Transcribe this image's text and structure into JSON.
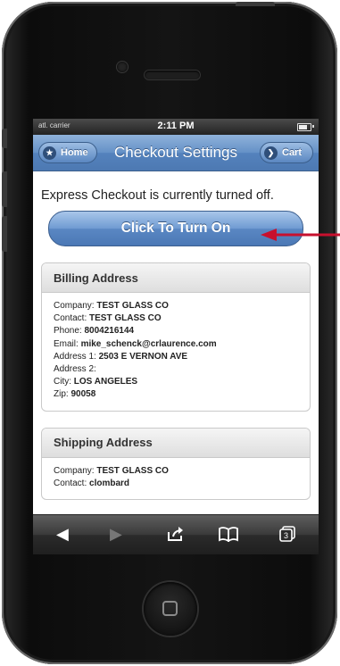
{
  "status_bar": {
    "carrier": "atl. carrier",
    "time": "2:11 PM"
  },
  "header": {
    "title": "Checkout Settings",
    "home_label": "Home",
    "cart_label": "Cart"
  },
  "main": {
    "message": "Express Checkout is currently turned off.",
    "turn_on_label": "Click To Turn On"
  },
  "billing": {
    "heading": "Billing Address",
    "company_label": "Company:",
    "company": "TEST GLASS CO",
    "contact_label": "Contact:",
    "contact": "TEST GLASS CO",
    "phone_label": "Phone:",
    "phone": "8004216144",
    "email_label": "Email:",
    "email": "mike_schenck@crlaurence.com",
    "address1_label": "Address 1:",
    "address1": "2503 E VERNON AVE",
    "address2_label": "Address 2:",
    "address2": "",
    "city_label": "City:",
    "city": "LOS ANGELES",
    "zip_label": "Zip:",
    "zip": "90058"
  },
  "shipping": {
    "heading": "Shipping Address",
    "company_label": "Company:",
    "company": "TEST GLASS CO",
    "contact_label": "Contact:",
    "contact": "clombard"
  },
  "toolbar": {
    "tabs_count": "3"
  },
  "colors": {
    "arrow": "#c8102e",
    "accent": "#5a87c3"
  }
}
